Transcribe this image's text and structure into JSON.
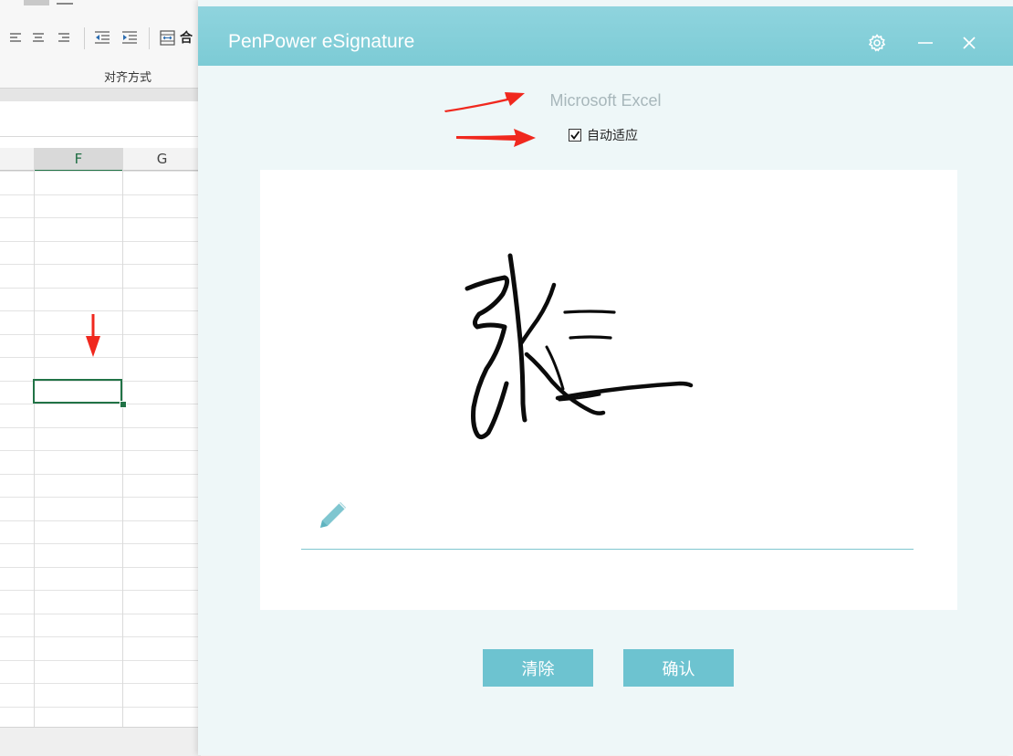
{
  "excel": {
    "ribbon_group_label": "对齐方式",
    "merge_button_label": "合",
    "columns": [
      {
        "label": "F",
        "selected": true
      },
      {
        "label": "G",
        "selected": false
      }
    ],
    "accent_color": "#217346"
  },
  "dialog": {
    "title": "PenPower eSignature",
    "app_name": "Microsoft Excel",
    "autofit_label": "自动适应",
    "autofit_checked": true,
    "signature_text": "张三",
    "clear_label": "清除",
    "confirm_label": "确认",
    "accent_color": "#6dc3d0",
    "titlebar_color": "#87d0da"
  },
  "annotations": {
    "arrow_color": "#f0281e"
  }
}
